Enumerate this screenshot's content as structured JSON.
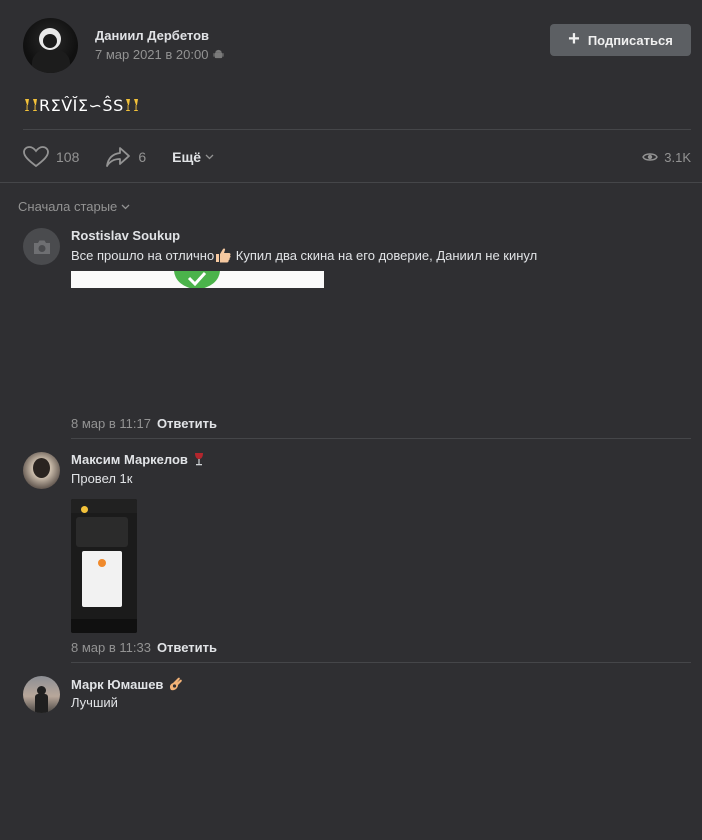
{
  "post": {
    "author": "Даниил Дербетов",
    "date": "7 мар 2021 в 20:00",
    "subscribe_label": "Подписаться",
    "text": "RΣV̂ĬΣ∽ŜS",
    "likes": "108",
    "shares": "6",
    "more_label": "Ещё",
    "views": "3.1K"
  },
  "sort_label": "Сначала старые",
  "comments": [
    {
      "author": "Rostislav Soukup",
      "text_before": "Все прошло на отлично",
      "text_after": " Купил два скина на его доверие, Даниил не кинул",
      "date": "8 мар в 11:17",
      "reply_label": "Ответить"
    },
    {
      "author": "Максим Маркелов",
      "text": "Провел 1к",
      "date": "8 мар в 11:33",
      "reply_label": "Ответить"
    },
    {
      "author": "Марк Юмашев",
      "text": "Лучший"
    }
  ],
  "colors": {
    "background": "#2f2f32",
    "text_primary": "#e1e3e6",
    "text_secondary": "#939393",
    "button_bg": "#5c5f63",
    "divider": "#454649"
  },
  "icons": [
    "camera-icon",
    "android-icon",
    "plus-icon",
    "heart-icon",
    "share-icon",
    "chevron-down-icon",
    "eye-icon",
    "champagne-icon",
    "thumbs-up-icon",
    "wine-icon",
    "ok-hand-icon"
  ]
}
